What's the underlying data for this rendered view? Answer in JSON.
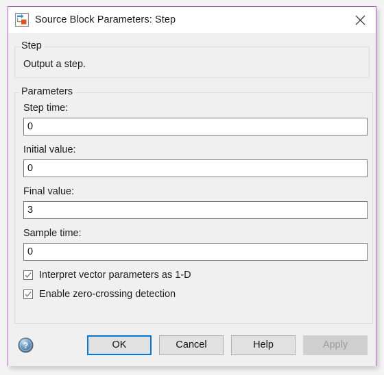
{
  "window": {
    "title": "Source Block Parameters: Step",
    "icon": "simulink-block-icon",
    "close_label": "✕",
    "border_color": "#b05ec0"
  },
  "description_group": {
    "legend": "Step",
    "text": "Output a step."
  },
  "parameters_group": {
    "legend": "Parameters",
    "fields": [
      {
        "label": "Step time:",
        "value": "0",
        "name": "step-time"
      },
      {
        "label": "Initial value:",
        "value": "0",
        "name": "initial-value"
      },
      {
        "label": "Final value:",
        "value": "3",
        "name": "final-value"
      },
      {
        "label": "Sample time:",
        "value": "0",
        "name": "sample-time"
      }
    ],
    "checkboxes": [
      {
        "label": "Interpret vector parameters as 1-D",
        "checked": true
      },
      {
        "label": "Enable zero-crossing detection",
        "checked": true
      }
    ]
  },
  "footer": {
    "help_icon": "help-circle-icon",
    "buttons": [
      {
        "label": "OK",
        "state": "default-focused"
      },
      {
        "label": "Cancel",
        "state": "normal"
      },
      {
        "label": "Help",
        "state": "normal"
      },
      {
        "label": "Apply",
        "state": "disabled"
      }
    ]
  },
  "colors": {
    "accent_focus": "#0078d7",
    "dialog_border": "#b05ec0",
    "body_background": "#f0f0f0",
    "titlebar_background": "#ffffff"
  }
}
